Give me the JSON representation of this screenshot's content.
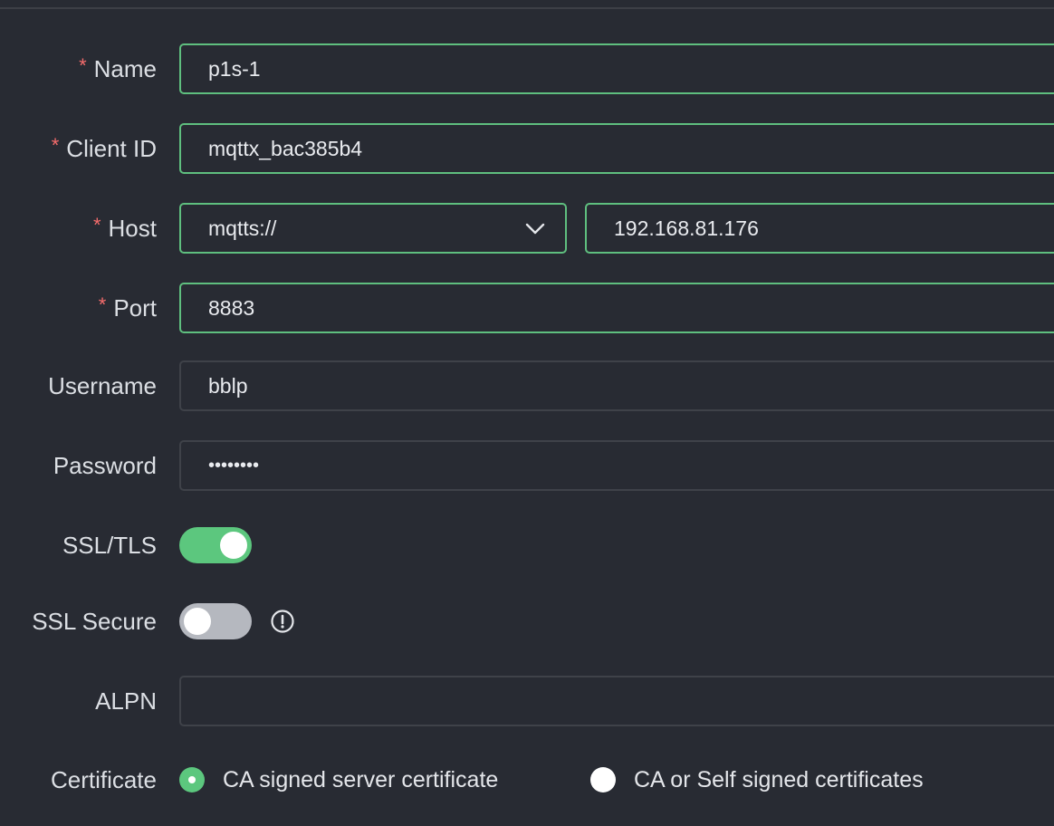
{
  "form": {
    "name": {
      "label": "Name",
      "required": "*",
      "value": "p1s-1"
    },
    "client_id": {
      "label": "Client ID",
      "required": "*",
      "value": "mqttx_bac385b4"
    },
    "host": {
      "label": "Host",
      "required": "*",
      "protocol": "mqtts://",
      "value": "192.168.81.176"
    },
    "port": {
      "label": "Port",
      "required": "*",
      "value": "8883"
    },
    "username": {
      "label": "Username",
      "value": "bblp"
    },
    "password": {
      "label": "Password",
      "value": "••••••••"
    },
    "ssl_tls": {
      "label": "SSL/TLS",
      "enabled": true
    },
    "ssl_secure": {
      "label": "SSL Secure",
      "enabled": false,
      "icon": "info-circle-icon"
    },
    "alpn": {
      "label": "ALPN",
      "value": ""
    },
    "certificate": {
      "label": "Certificate",
      "options": [
        "CA signed server certificate",
        "CA or Self signed certificates"
      ],
      "selected": "CA signed server certificate"
    }
  },
  "colors": {
    "background": "#282b33",
    "accent": "#5cc77e",
    "required_star": "#f56c6c",
    "field_border": "#3f4249",
    "switch_off": "#b5b8bf"
  }
}
